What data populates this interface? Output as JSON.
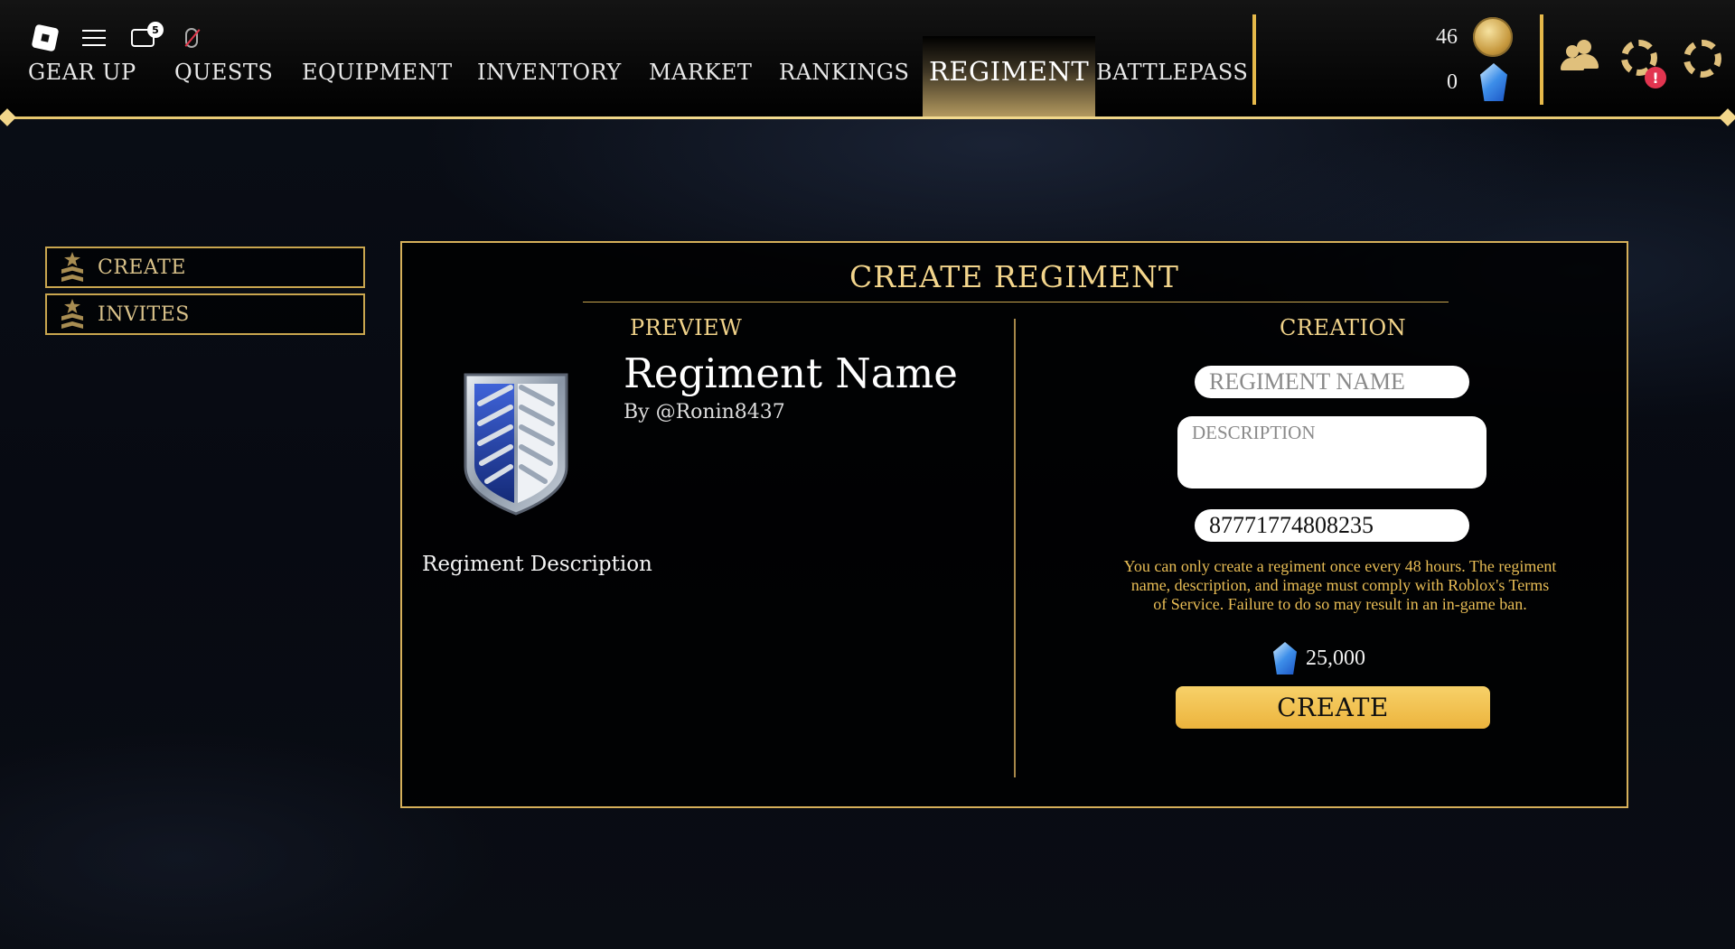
{
  "topbar": {
    "chat_badge": "5",
    "nav": [
      "GEAR UP",
      "QUESTS",
      "EQUIPMENT",
      "INVENTORY",
      "MARKET",
      "RANKINGS",
      "REGIMENT",
      "BATTLEPASS"
    ],
    "active_tab": "REGIMENT",
    "gold_amount": "46",
    "crystal_amount": "0",
    "alert_badge": "!"
  },
  "sidebar": {
    "items": [
      {
        "label": "CREATE"
      },
      {
        "label": "INVITES"
      }
    ]
  },
  "panel": {
    "title": "CREATE REGIMENT",
    "preview_label": "PREVIEW",
    "creation_label": "CREATION",
    "preview_name": "Regiment Name",
    "preview_by": "By @Ronin8437",
    "preview_description": "Regiment Description",
    "name_placeholder": "REGIMENT NAME",
    "description_placeholder": "DESCRIPTION",
    "image_id_value": "87771774808235",
    "notice": "You can only create a regiment once every 48 hours. The regiment name, description, and image must comply with Roblox's Terms of Service. Failure to do so may result in an in-game ban.",
    "cost": "25,000",
    "create_button": "CREATE"
  },
  "colors": {
    "accent_gold": "#e6c66d",
    "button_gold": "#f0bd45",
    "notice_text": "#e8bd55",
    "badge_red": "#e23550"
  },
  "icons": [
    "roblox-logo-icon",
    "menu-icon",
    "chat-icon",
    "mic-muted-icon",
    "gold-coin-icon",
    "crystal-icon",
    "friends-icon",
    "achievements-icon",
    "settings-icon",
    "rank-chevron-icon",
    "regiment-emblem-icon"
  ]
}
